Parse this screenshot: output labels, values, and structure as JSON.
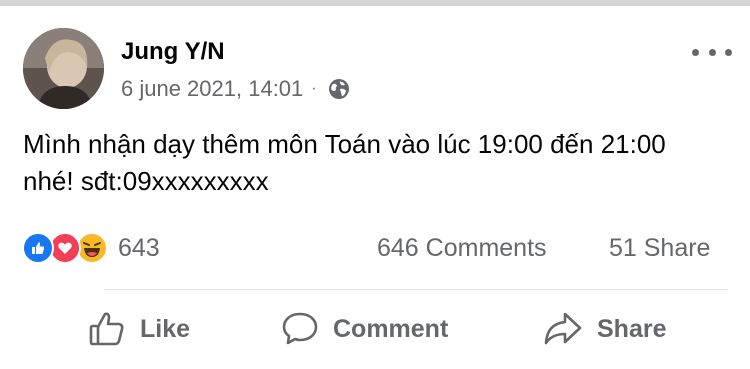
{
  "post": {
    "author": "Jung Y/N",
    "timestamp": "6 june 2021, 14:01",
    "separator": "·",
    "privacy_icon": "globe-icon",
    "text": "Mình nhận dạy thêm môn Toán vào lúc 19:00 đến 21:00 nhé! sđt:09xxxxxxxxx"
  },
  "stats": {
    "reaction_icons": [
      "like-icon",
      "love-icon",
      "haha-icon"
    ],
    "reactions_count": "643",
    "comments": "646 Comments",
    "shares": "51 Share"
  },
  "actions": {
    "like": "Like",
    "comment": "Comment",
    "share": "Share"
  },
  "colors": {
    "like_blue": "#1877f2",
    "love_red": "#f33e58",
    "haha_yellow": "#f7b928",
    "secondary_text": "#65676b"
  }
}
